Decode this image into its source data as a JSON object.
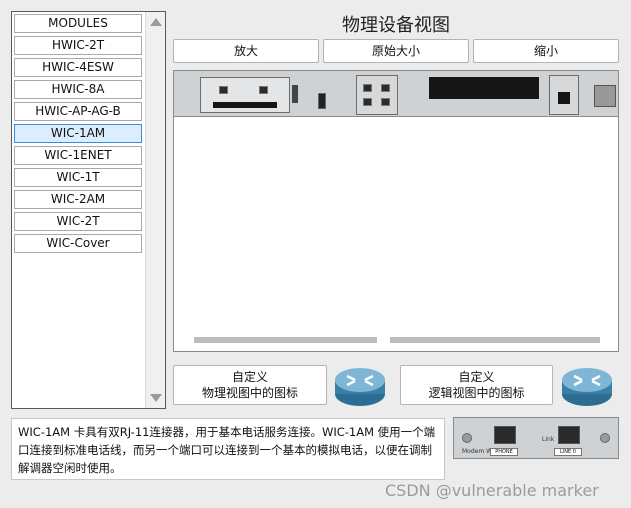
{
  "modules": {
    "items": [
      {
        "label": "MODULES"
      },
      {
        "label": "HWIC-2T"
      },
      {
        "label": "HWIC-4ESW"
      },
      {
        "label": "HWIC-8A"
      },
      {
        "label": "HWIC-AP-AG-B"
      },
      {
        "label": "WIC-1AM"
      },
      {
        "label": "WIC-1ENET"
      },
      {
        "label": "WIC-1T"
      },
      {
        "label": "WIC-2AM"
      },
      {
        "label": "WIC-2T"
      },
      {
        "label": "WIC-Cover"
      }
    ],
    "selected": "WIC-1AM"
  },
  "view": {
    "title": "物理设备视图",
    "zoom_in": "放大",
    "original_size": "原始大小",
    "zoom_out": "缩小"
  },
  "custom": {
    "physical_line1": "自定义",
    "physical_line2": "物理视图中的图标",
    "logical_line1": "自定义",
    "logical_line2": "逻辑视图中的图标"
  },
  "description": {
    "text": "WIC-1AM 卡具有双RJ-11连接器，用于基本电话服务连接。WIC-1AM 使用一个端口连接到标准电话线，而另一个端口可以连接到一个基本的模拟电话，以便在调制解调器空闲时使用。"
  },
  "module_image": {
    "model_label": "Modem WIC-1AM",
    "phone_label": "PHONE",
    "line_label": "LINE 0",
    "link_label": "Link"
  },
  "watermark": {
    "text": "CSDN @vulnerable marker"
  },
  "colors": {
    "selected_bg": "#dbeeff",
    "selected_border": "#3c8bd9",
    "router_blue": "#3a7fa6"
  }
}
